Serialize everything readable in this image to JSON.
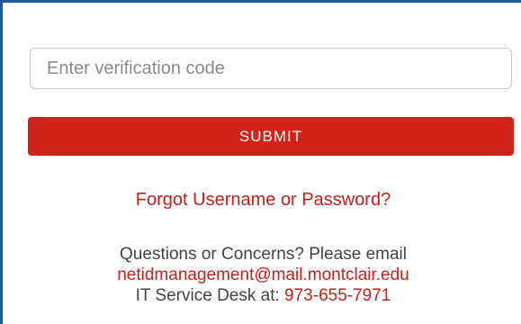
{
  "verification": {
    "placeholder": "Enter verification code"
  },
  "submit": {
    "label": "SUBMIT"
  },
  "forgot": {
    "label": "Forgot Username or Password?"
  },
  "contact": {
    "intro": "Questions or Concerns? Please email",
    "email": "netidmanagement@mail.montclair.edu",
    "desk_prefix": "IT Service Desk at:",
    "phone": "973-655-7971"
  },
  "colors": {
    "accent": "#d0241a",
    "link": "#c3211b",
    "frame": "#1f5a96"
  }
}
